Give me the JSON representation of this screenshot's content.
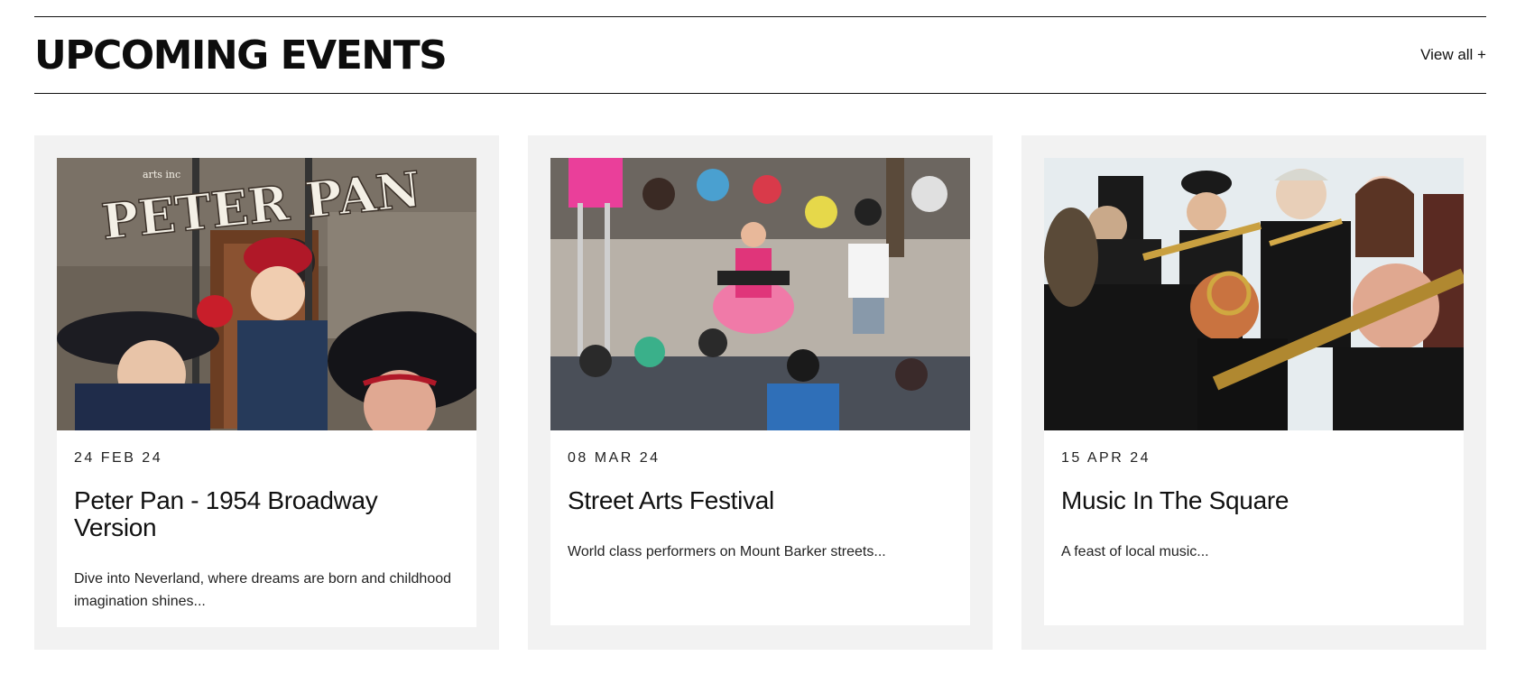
{
  "section": {
    "title": "UPCOMING EVENTS",
    "view_all": "View all +"
  },
  "events": [
    {
      "date": "24 FEB 24",
      "title": "Peter Pan - 1954 Broadway Version",
      "description": "Dive into Neverland, where dreams are born and childhood imagination shines...",
      "image_text": "PETER PAN",
      "image_small_text": "arts inc"
    },
    {
      "date": "08 MAR 24",
      "title": "Street Arts Festival",
      "description": "World class performers on Mount Barker streets..."
    },
    {
      "date": "15 APR 24",
      "title": "Music In The Square",
      "description": "A feast of local music..."
    }
  ],
  "colors": {
    "card_background": "#f2f2f2",
    "rule": "#111111"
  }
}
